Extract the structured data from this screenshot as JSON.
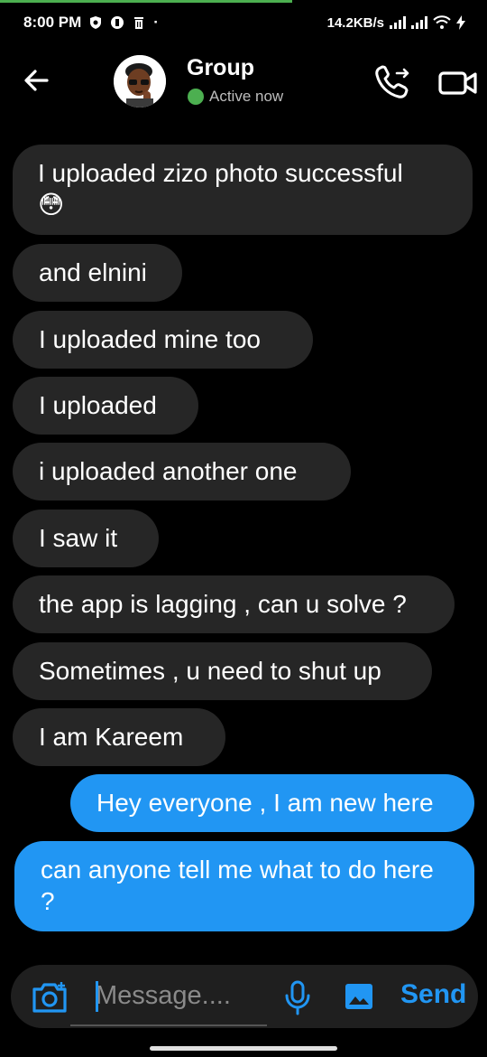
{
  "status_bar": {
    "time": "8:00 PM",
    "net_speed": "14.2KB/s",
    "dot": "·"
  },
  "header": {
    "title": "Group",
    "status": "Active now",
    "status_color": "#4caf50"
  },
  "messages": [
    {
      "text": "I uploaded zizo photo successful",
      "emoji": "😳",
      "type": "received"
    },
    {
      "text": "and elnini",
      "type": "received"
    },
    {
      "text": "I uploaded mine too",
      "type": "received"
    },
    {
      "text": "I uploaded",
      "type": "received"
    },
    {
      "text": "i uploaded another one",
      "type": "received"
    },
    {
      "text": "I saw it",
      "type": "received"
    },
    {
      "text": "the app is lagging , can u solve ?",
      "type": "received"
    },
    {
      "text": "Sometimes , u need to shut up",
      "type": "received"
    },
    {
      "text": "I  am Kareem",
      "type": "received"
    },
    {
      "text": "Hey everyone , I am new here",
      "type": "sent"
    },
    {
      "text": "can anyone tell me what to do here ?",
      "type": "sent"
    }
  ],
  "composer": {
    "placeholder": "Message....",
    "send_label": "Send"
  },
  "colors": {
    "accent": "#2196f3",
    "received_bubble": "#262626",
    "background": "#000000"
  },
  "icons": [
    "back-arrow-icon",
    "phone-transfer-icon",
    "video-camera-icon",
    "camera-switch-icon",
    "microphone-icon",
    "image-gallery-icon"
  ]
}
